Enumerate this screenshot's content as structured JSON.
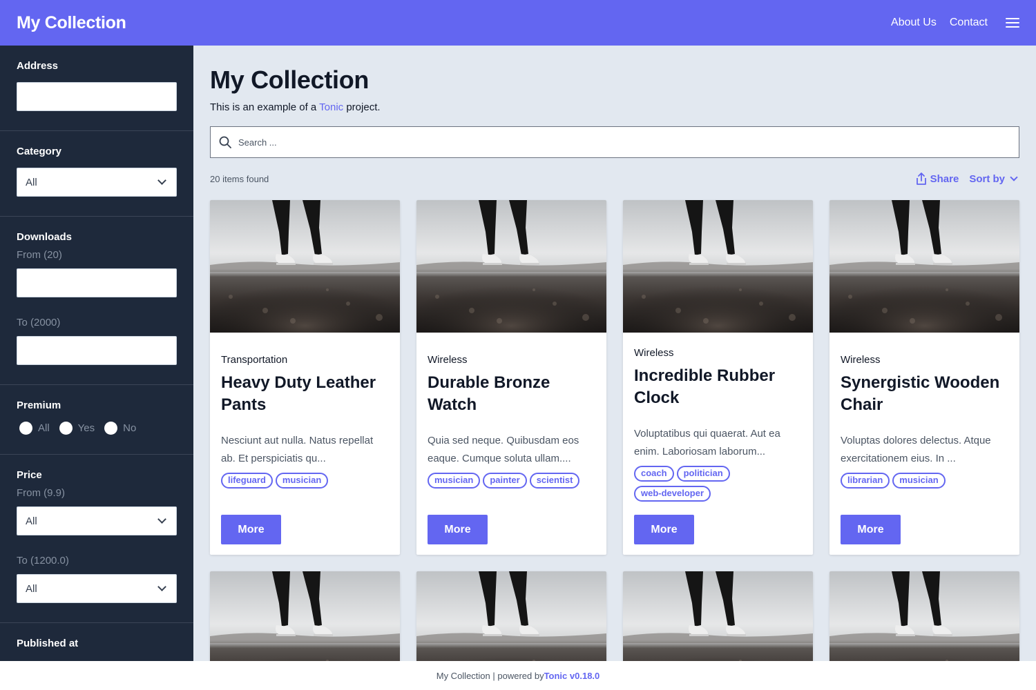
{
  "header": {
    "brand": "My Collection",
    "nav": [
      {
        "label": "About Us"
      },
      {
        "label": "Contact"
      }
    ],
    "menu_icon": "hamburger-icon"
  },
  "sidebar": {
    "address": {
      "label": "Address",
      "value": ""
    },
    "category": {
      "label": "Category",
      "value": "All"
    },
    "downloads": {
      "label": "Downloads",
      "from_label": "From (20)",
      "from_value": "",
      "to_label": "To (2000)",
      "to_value": ""
    },
    "premium": {
      "label": "Premium",
      "options": [
        "All",
        "Yes",
        "No"
      ]
    },
    "price": {
      "label": "Price",
      "from_label": "From (9.9)",
      "from_value": "All",
      "to_label": "To (1200.0)",
      "to_value": "All"
    },
    "published": {
      "label": "Published at"
    }
  },
  "main": {
    "title": "My Collection",
    "description_prefix": "This is an example of a ",
    "description_link": "Tonic",
    "description_suffix": " project.",
    "search_placeholder": "Search ...",
    "results_count": "20 items found",
    "share_label": "Share",
    "sort_label": "Sort by",
    "more_label": "More",
    "cards": [
      {
        "category": "Transportation",
        "title": "Heavy Duty Leather Pants",
        "description": "Nesciunt aut nulla. Natus repellat ab. Et perspiciatis qu...",
        "tags": [
          "lifeguard",
          "musician"
        ]
      },
      {
        "category": "Wireless",
        "title": "Durable Bronze Watch",
        "description": "Quia sed neque. Quibusdam eos eaque. Cumque soluta ullam....",
        "tags": [
          "musician",
          "painter",
          "scientist"
        ]
      },
      {
        "category": "Wireless",
        "title": "Incredible Rubber Clock",
        "description": "Voluptatibus qui quaerat. Aut ea enim. Laboriosam laborum...",
        "tags": [
          "coach",
          "politician",
          "web-developer"
        ]
      },
      {
        "category": "Wireless",
        "title": "Synergistic Wooden Chair",
        "description": "Voluptas dolores delectus. Atque exercitationem eius. In ...",
        "tags": [
          "librarian",
          "musician"
        ]
      }
    ]
  },
  "footer": {
    "text": "My Collection | powered by ",
    "link": "Tonic v0.18.0"
  },
  "colors": {
    "accent": "#6366f1",
    "sidebar_bg": "#1e293b",
    "page_bg": "#e2e8f0"
  }
}
